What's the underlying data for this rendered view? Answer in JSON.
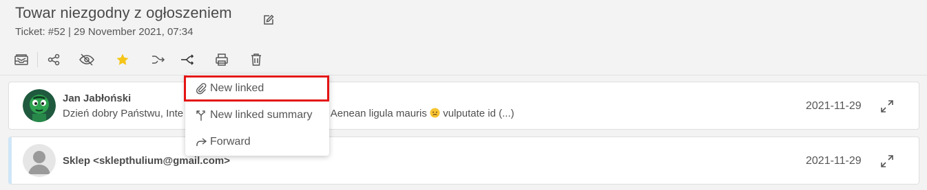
{
  "ticket": {
    "title": "Towar niezgodny z ogłoszeniem",
    "subtitle": "Ticket: #52 | 29 November 2021, 07:34"
  },
  "toolbar": {
    "icons": [
      "inbox-icon",
      "share-icon",
      "eye-off-icon",
      "star-icon",
      "merge-icon",
      "split-icon",
      "print-icon",
      "trash-icon"
    ],
    "star_color": "#f5c518"
  },
  "messages": [
    {
      "sender": "Jan Jabłoński",
      "snippet_before": "Dzień dobry Państwu, Inte",
      "snippet_after": "bus. Aenean ligula mauris",
      "snippet_end": "vulputate id (...)",
      "date": "2021-11-29",
      "avatar": "green-character-avatar"
    },
    {
      "sender": "Sklep <sklepthulium@gmail.com>",
      "date": "2021-11-29",
      "avatar": "default-person-avatar"
    }
  ],
  "dropdown": {
    "items": [
      {
        "label": "New linked",
        "icon": "paperclip-icon"
      },
      {
        "label": "New linked summary",
        "icon": "split-arrow-icon"
      },
      {
        "label": "Forward",
        "icon": "forward-arrow-icon"
      }
    ],
    "highlight_color": "#e41313"
  }
}
